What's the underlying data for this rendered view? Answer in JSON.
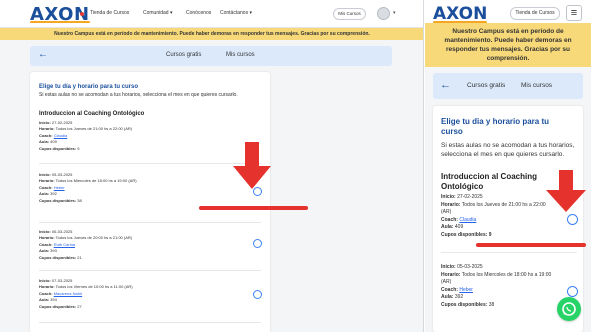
{
  "brand": {
    "logo_text": "AXON",
    "primary_color": "#1b4f9c",
    "accent_color": "#f5a623",
    "annotation_color": "#e5322d"
  },
  "desktop": {
    "nav": {
      "items": [
        "Tienda de Cursos",
        "Comunidad ▾",
        "Conócenos",
        "Contáctanos ▾"
      ],
      "mis_cursos_label": "Mis Cursos",
      "avatar_chevron": "▾"
    },
    "banner": "Nuestro Campus está en período de mantenimiento. Puede haber demoras en responder tus mensajes. Gracias por su comprensión.",
    "tabs": {
      "back_icon": "←",
      "items": [
        "Cursos gratis",
        "Mis cursos"
      ]
    },
    "card": {
      "title": "Elige tu día y horario para tu curso",
      "description": "Si estas aulas no se acomodan a tus horarios, selecciona el mes en que quieres cursarlo.",
      "course_title": "Introduccion al Coaching Ontológico"
    },
    "sessions": [
      {
        "inicio": "27-02-2025",
        "horario": "Todos los Jueves de 21:00 hs a 22:00 (AR)",
        "coach": "Claudia",
        "aula": "409",
        "cupos": "9"
      },
      {
        "inicio": "05-03-2025",
        "horario": "Todos los Miercoles de 18:00 hs a 19:00 (AR)",
        "coach": "Heber",
        "aula": "392",
        "cupos": "38"
      },
      {
        "inicio": "06-03-2025",
        "horario": "Todos los Jueves de 20:00 hs a 21:00 (AR)",
        "coach": "Ruth Carina",
        "aula": "393",
        "cupos": "21"
      },
      {
        "inicio": "07-03-2025",
        "horario": "Todos los Viernes de 10:00 hs a 11:00 (AR)",
        "coach": "Macarena Nahir",
        "aula": "394",
        "cupos": "27"
      }
    ]
  },
  "labels": {
    "inicio": "Inicio:",
    "horario": "Horario:",
    "coach": "Coach:",
    "aula": "Aula:",
    "cupos": "Cupos disponibles:"
  },
  "mobile": {
    "nav": {
      "tienda_label": "Tienda de Cursos",
      "menu_icon": "≡"
    },
    "banner": "Nuestro Campus está en período de mantenimiento. Puede haber demoras en responder tus mensajes. Gracias por su comprensión.",
    "tabs": {
      "back_icon": "←",
      "items": [
        "Cursos gratis",
        "Mis cursos"
      ]
    },
    "card": {
      "title": "Elige tu dia y horario para tu curso",
      "description": "Si estas aulas no se acomodan a tus horarios, selecciona el mes en que quieres cursarlo.",
      "course_title": "Introduccion al Coaching Ontológico"
    },
    "session1": {
      "inicio": "27-02-2025",
      "horario": "Todos los Jueves de 21:00 hs a 22:00 (AR)",
      "coach": "Claudia",
      "aula": "409",
      "cupos_label": "Cupos disponibles: 9"
    },
    "session2": {
      "inicio": "05-03-2025",
      "horario": "Todos los Miercoles de 18:00 hs a 19:00 (AR)",
      "coach": "Heber",
      "aula": "392",
      "cupos": "38"
    },
    "whatsapp_icon": "whatsapp-icon"
  }
}
